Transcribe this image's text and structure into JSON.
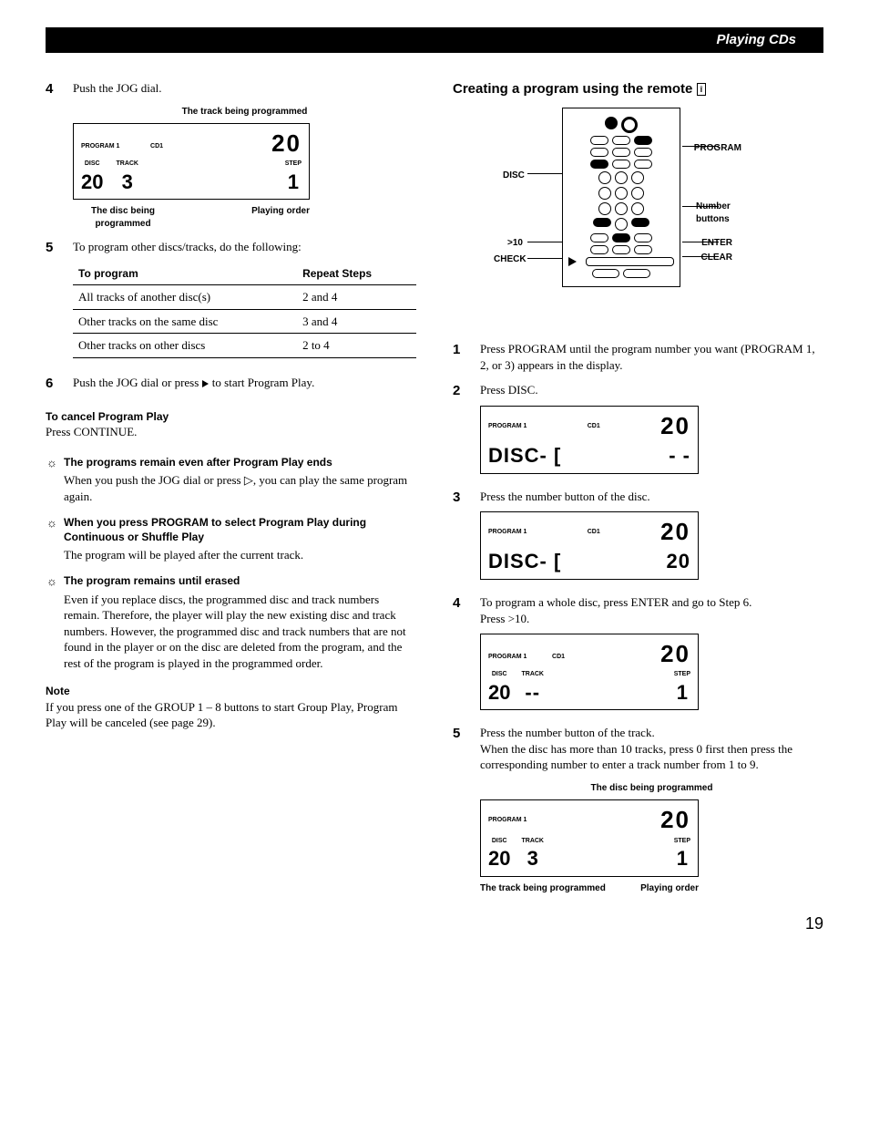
{
  "header": {
    "section": "Playing CDs"
  },
  "left": {
    "step4": {
      "num": "4",
      "text": "Push the JOG dial.",
      "annot_top": "The track being programmed",
      "annot_left": "The disc being programmed",
      "annot_right": "Playing order",
      "disp": {
        "program": "PROGRAM 1",
        "cd": "CD1",
        "disc_lbl": "DISC",
        "disc_val": "20",
        "track_lbl": "TRACK",
        "track_val": "3",
        "big": "20",
        "step_lbl": "STEP",
        "step_val": "1"
      }
    },
    "step5": {
      "num": "5",
      "text": "To program other discs/tracks, do the following:",
      "th1": "To program",
      "th2": "Repeat Steps",
      "rows": [
        {
          "a": "All tracks of another disc(s)",
          "b": "2 and 4"
        },
        {
          "a": "Other tracks on the same disc",
          "b": "3 and 4"
        },
        {
          "a": "Other tracks on other discs",
          "b": "2 to 4"
        }
      ]
    },
    "step6": {
      "num": "6",
      "text_a": "Push the JOG dial or press ",
      "text_b": " to start Program Play."
    },
    "cancel": {
      "head": "To cancel Program Play",
      "body": "Press CONTINUE."
    },
    "tip1": {
      "head": "The programs remain even after Program Play ends",
      "body": "When you push the JOG dial or press ▷, you can play the same program again."
    },
    "tip2": {
      "head": "When you press PROGRAM to select Program Play during Continuous or Shuffle Play",
      "body": "The program will be played after the current track."
    },
    "tip3": {
      "head": "The program remains until erased",
      "body": "Even if you replace discs, the programmed disc and track numbers remain. Therefore, the player will play the new existing disc and track numbers. However, the programmed disc and track numbers that are not found in the player or on the disc are deleted from the program, and the rest of the program is played in the programmed order."
    },
    "note": {
      "head": "Note",
      "body": "If you press one of the GROUP 1 – 8 buttons to start Group Play, Program Play will be canceled (see page 29)."
    }
  },
  "right": {
    "heading": "Creating a program using the remote",
    "remote_labels": {
      "program": "PROGRAM",
      "disc": "DISC",
      "number": "Number buttons",
      "gt10": ">10",
      "enter": "ENTER",
      "check": "CHECK",
      "clear": "CLEAR"
    },
    "step1": {
      "num": "1",
      "text": "Press PROGRAM until the program number you want (PROGRAM 1, 2, or 3) appears in the display."
    },
    "step2": {
      "num": "2",
      "text": "Press DISC.",
      "disp": {
        "program": "PROGRAM 1",
        "cd": "CD1",
        "line": "DISC- [",
        "big": "20",
        "blink": "- -"
      }
    },
    "step3": {
      "num": "3",
      "text": "Press the number button of the disc.",
      "disp": {
        "program": "PROGRAM 1",
        "cd": "CD1",
        "line": "DISC- [",
        "big": "20",
        "disc_val": "20"
      }
    },
    "step4": {
      "num": "4",
      "text_a": "To program a whole disc, press ENTER and go to Step 6.",
      "text_b": "Press >10.",
      "disp": {
        "program": "PROGRAM 1",
        "cd": "CD1",
        "disc_lbl": "DISC",
        "disc_val": "20",
        "track_lbl": "TRACK",
        "track_val": "--",
        "big": "20",
        "step_lbl": "STEP",
        "step_val": "1"
      }
    },
    "step5": {
      "num": "5",
      "text_a": "Press the number button of the track.",
      "text_b": "When the disc has more than 10 tracks, press 0 first then press the corresponding number to enter a track number from 1 to 9.",
      "annot_top": "The disc being programmed",
      "annot_left": "The track being programmed",
      "annot_right": "Playing order",
      "disp": {
        "program": "PROGRAM 1",
        "disc_lbl": "DISC",
        "disc_val": "20",
        "track_lbl": "TRACK",
        "track_val": "3",
        "big": "20",
        "step_lbl": "STEP",
        "step_val": "1"
      }
    }
  },
  "page_number": "19"
}
